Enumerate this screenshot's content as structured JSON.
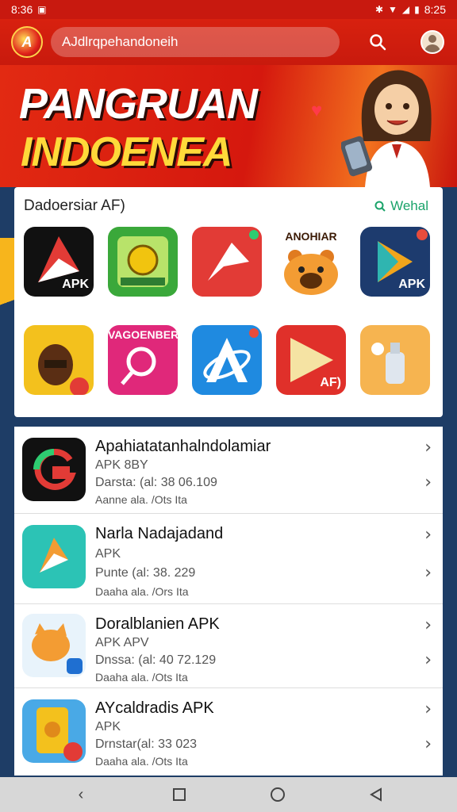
{
  "status_bar": {
    "time_left": "8:36",
    "time_right": "8:25"
  },
  "app_bar": {
    "logo_text": "A",
    "search_value": "AJdlrqpehandoneih"
  },
  "banner": {
    "line1": "PANGRUAN",
    "line2": "INDOENEA"
  },
  "featured": {
    "title": "Dadoersiar AF)",
    "link": "Wehal",
    "apps": [
      {
        "name": "apk-red-arrow",
        "label": "APK",
        "bg": "#111111"
      },
      {
        "name": "green-badge",
        "label": "",
        "bg": "#3aa83a"
      },
      {
        "name": "red-arrow",
        "label": "",
        "bg": "#e23b36"
      },
      {
        "name": "bear",
        "label": "ANOHIAR",
        "bg": "#ffffff"
      },
      {
        "name": "play-apk",
        "label": "APK",
        "bg": "#1d3b6e"
      },
      {
        "name": "character-yellow",
        "label": "",
        "bg": "#f3c11d"
      },
      {
        "name": "pink-search",
        "label": "VAGOENBER",
        "bg": "#e0287a"
      },
      {
        "name": "blue-a",
        "label": "",
        "bg": "#1f8ae0"
      },
      {
        "name": "red-play-af",
        "label": "AF)",
        "bg": "#e0302a"
      },
      {
        "name": "orange-bottle",
        "label": "",
        "bg": "#f6b450"
      }
    ]
  },
  "list": [
    {
      "name": "Apahiatatanhalndolamiar",
      "sub": "APK 8BY",
      "date": "Darsta: (al: 38 06.109",
      "size": "Aanne ala. /Ots Ita"
    },
    {
      "name": "Narla Nadajadand",
      "sub": "APK",
      "date": "Punte (al: 38. 229",
      "size": "Daaha ala. /Ors Ita"
    },
    {
      "name": "Doralblanien APK",
      "sub": "APK APV",
      "date": "Dnssa: (al: 40 72.129",
      "size": "Daaha ala. /Ots Ita"
    },
    {
      "name": "AYcaldradis APK",
      "sub": "APK",
      "date": "Drnstar(al: 33 023",
      "size": "Daaha ala. /Ots Ita"
    }
  ]
}
